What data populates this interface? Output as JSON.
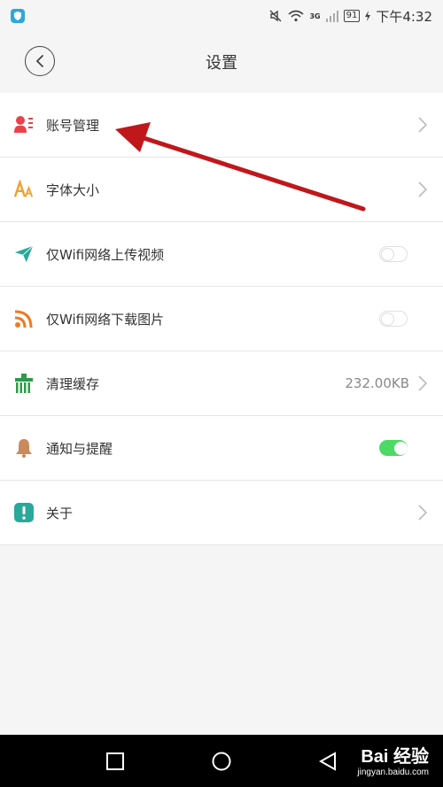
{
  "status_bar": {
    "network_label": "3G",
    "battery": "91",
    "time": "下午4:32"
  },
  "header": {
    "title": "设置"
  },
  "settings": {
    "items": [
      {
        "label": "账号管理",
        "icon": "account-icon",
        "color": "#e8434a",
        "control": "chevron"
      },
      {
        "label": "字体大小",
        "icon": "font-size-icon",
        "color": "#f0a030",
        "control": "chevron"
      },
      {
        "label": "仅Wifi网络上传视频",
        "icon": "upload-plane-icon",
        "color": "#2aa89a",
        "control": "toggle",
        "on": false
      },
      {
        "label": "仅Wifi网络下载图片",
        "icon": "rss-download-icon",
        "color": "#f07a20",
        "control": "toggle",
        "on": false
      },
      {
        "label": "清理缓存",
        "icon": "clean-cache-icon",
        "color": "#2e9a4a",
        "value": "232.00KB",
        "control": "chevron"
      },
      {
        "label": "通知与提醒",
        "icon": "bell-icon",
        "color": "#c98a5c",
        "control": "toggle",
        "on": true
      },
      {
        "label": "关于",
        "icon": "about-icon",
        "color": "#2aa89a",
        "control": "chevron"
      }
    ]
  },
  "watermark": {
    "main": "Bai 经验",
    "sub": "jingyan.baidu.com"
  },
  "colors": {
    "toggle_on": "#4cd964",
    "arrow": "#c0171b"
  }
}
